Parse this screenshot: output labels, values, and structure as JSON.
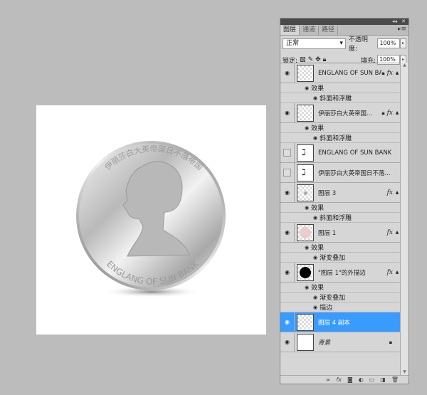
{
  "canvas": {
    "coin": {
      "top_text": "伊丽莎白大英帝国日不落帝国",
      "bottom_text": "ENGLANG OF SUN BANK"
    }
  },
  "panel": {
    "tabs": [
      {
        "label": "图层",
        "active": true
      },
      {
        "label": "通道"
      },
      {
        "label": "路径"
      }
    ],
    "blend_mode": "正常",
    "opacity_label": "不透明度:",
    "opacity": "100%",
    "lock_label": "锁定:",
    "fill_label": "填充:",
    "fill": "100%",
    "layers": [
      {
        "name": "ENGLANG OF SUN BA...",
        "visible": true,
        "thumb": "transparent",
        "lock": true,
        "fx": true,
        "effects_label": "效果",
        "effects": [
          "斜面和浮雕"
        ]
      },
      {
        "name": "伊丽莎白大英帝国...",
        "visible": true,
        "thumb": "transparent",
        "lock": true,
        "fx": true,
        "effects_label": "效果",
        "effects": [
          "斜面和浮雕"
        ]
      },
      {
        "name": "ENGLANG OF SUN BANK",
        "visible": false,
        "thumb": "text"
      },
      {
        "name": "伊丽莎白大英帝国日不落...",
        "visible": false,
        "thumb": "text"
      },
      {
        "name": "图层 3",
        "visible": true,
        "thumb": "dot",
        "fx": true,
        "effects_label": "效果",
        "effects": [
          "斜面和浮雕"
        ]
      },
      {
        "name": "图层 1",
        "visible": true,
        "thumb": "pink",
        "fx": true,
        "effects_label": "效果",
        "effects": [
          "渐变叠加"
        ]
      },
      {
        "name": "\"图层 1\"的外描边",
        "visible": true,
        "thumb": "black",
        "fx": true,
        "effects_label": "效果",
        "effects": [
          "渐变叠加",
          "描边"
        ]
      },
      {
        "name": "图层 4 副本",
        "visible": true,
        "thumb": "transparent",
        "selected": true
      },
      {
        "name": "背景",
        "visible": true,
        "thumb": "white",
        "lock": true,
        "italic": true
      }
    ],
    "accent": "#3a9bff"
  }
}
